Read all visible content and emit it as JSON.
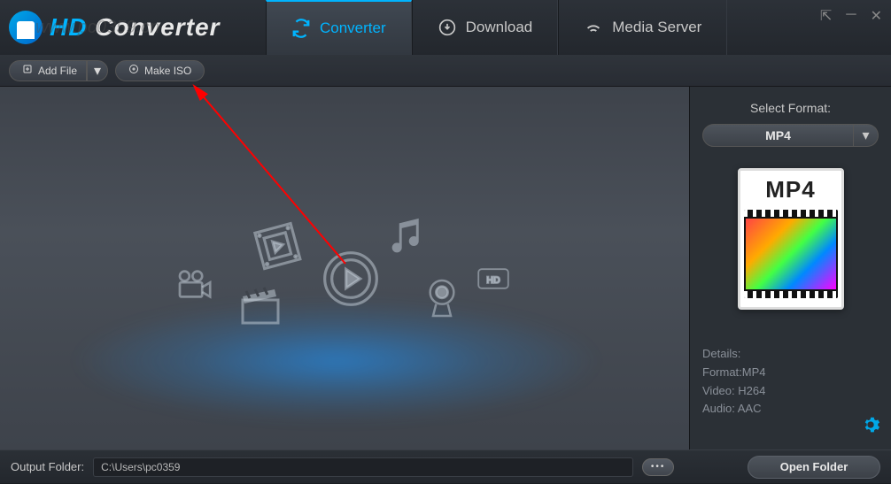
{
  "app": {
    "title_prefix": "HD",
    "title_suffix": "Converter"
  },
  "watermark": "www.pc0359.cn",
  "tabs": {
    "converter": "Converter",
    "download": "Download",
    "media_server": "Media Server"
  },
  "toolbar": {
    "add_file": "Add File",
    "make_iso": "Make ISO"
  },
  "sidebar": {
    "select_format_label": "Select Format:",
    "format_value": "MP4",
    "preview_label": "MP4",
    "details_heading": "Details:",
    "format_line": "Format:MP4",
    "video_line": "Video: H264",
    "audio_line": "Audio: AAC"
  },
  "footer": {
    "label": "Output Folder:",
    "path": "C:\\Users\\pc0359",
    "open_folder": "Open Folder"
  }
}
